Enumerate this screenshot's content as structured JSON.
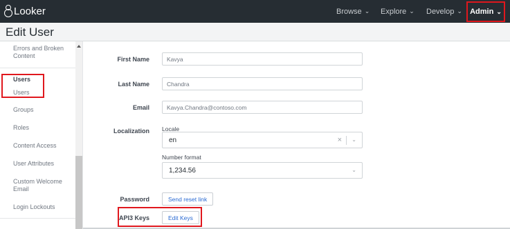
{
  "topbar": {
    "logo_text": "Looker",
    "nav": [
      {
        "label": "Browse"
      },
      {
        "label": "Explore"
      },
      {
        "label": "Develop"
      },
      {
        "label": "Admin"
      }
    ]
  },
  "header": {
    "title": "Edit User"
  },
  "sidebar": {
    "items": [
      {
        "label": "Errors and Broken Content"
      },
      {
        "label": "Users"
      },
      {
        "label": "Users"
      },
      {
        "label": "Groups"
      },
      {
        "label": "Roles"
      },
      {
        "label": "Content Access"
      },
      {
        "label": "User Attributes"
      },
      {
        "label": "Custom Welcome Email"
      },
      {
        "label": "Login Lockouts"
      }
    ]
  },
  "form": {
    "first_name": {
      "label": "First Name",
      "value": "Kavya"
    },
    "last_name": {
      "label": "Last Name",
      "value": "Chandra"
    },
    "email": {
      "label": "Email",
      "value": "Kavya.Chandra@contoso.com"
    },
    "localization": {
      "label": "Localization",
      "locale_label": "Locale",
      "locale_value": "en",
      "number_format_label": "Number format",
      "number_format_value": "1,234.56"
    },
    "password": {
      "label": "Password",
      "button": "Send reset link"
    },
    "api3_keys": {
      "label": "API3 Keys",
      "button": "Edit Keys"
    }
  },
  "icons": {
    "clear": "×",
    "chevron": "⌄"
  },
  "colors": {
    "topbar_bg": "#262d33",
    "highlight_red": "#e0171d",
    "link_blue": "#2b6bd3"
  }
}
